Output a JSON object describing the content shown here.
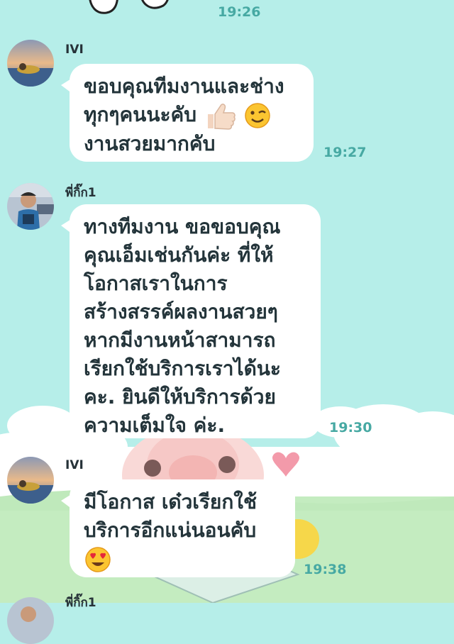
{
  "chat": {
    "top_time": "19:26",
    "messages": [
      {
        "sender": "IVI",
        "lines": [
          "ขอบคุณทีมงานและช่าง",
          "ทุกๆคนนะคับ",
          "งานสวยมากคับ"
        ],
        "emojis": [
          "thumbs-up-icon",
          "wink-face-icon"
        ],
        "time": "19:27"
      },
      {
        "sender": "พี่กิ๊ก1",
        "lines": [
          "ทางทีมงาน ขอขอบคุณ",
          "คุณเอ็มเช่นกันค่ะ ที่ให้",
          "โอกาสเราในการ",
          "สร้างสรรค์ผลงานสวยๆ",
          "หากมีงานหน้าสามารถ",
          "เรียกใช้บริการเราได้นะ",
          "คะ. ยินดีให้บริการด้วย",
          "ความเต็มใจ ค่ะ."
        ],
        "time": "19:30"
      },
      {
        "sender": "IVI",
        "lines": [
          "มีโอกาส เด๋วเรียกใช้",
          "บริการอีกแน่นอนคับ"
        ],
        "emojis": [
          "heart-eyes-face-icon"
        ],
        "time": "19:38"
      },
      {
        "sender": "พี่กิ๊ก1"
      }
    ]
  },
  "colors": {
    "background": "#b6eee9",
    "bubble": "#ffffff",
    "time": "#47a9a3"
  }
}
